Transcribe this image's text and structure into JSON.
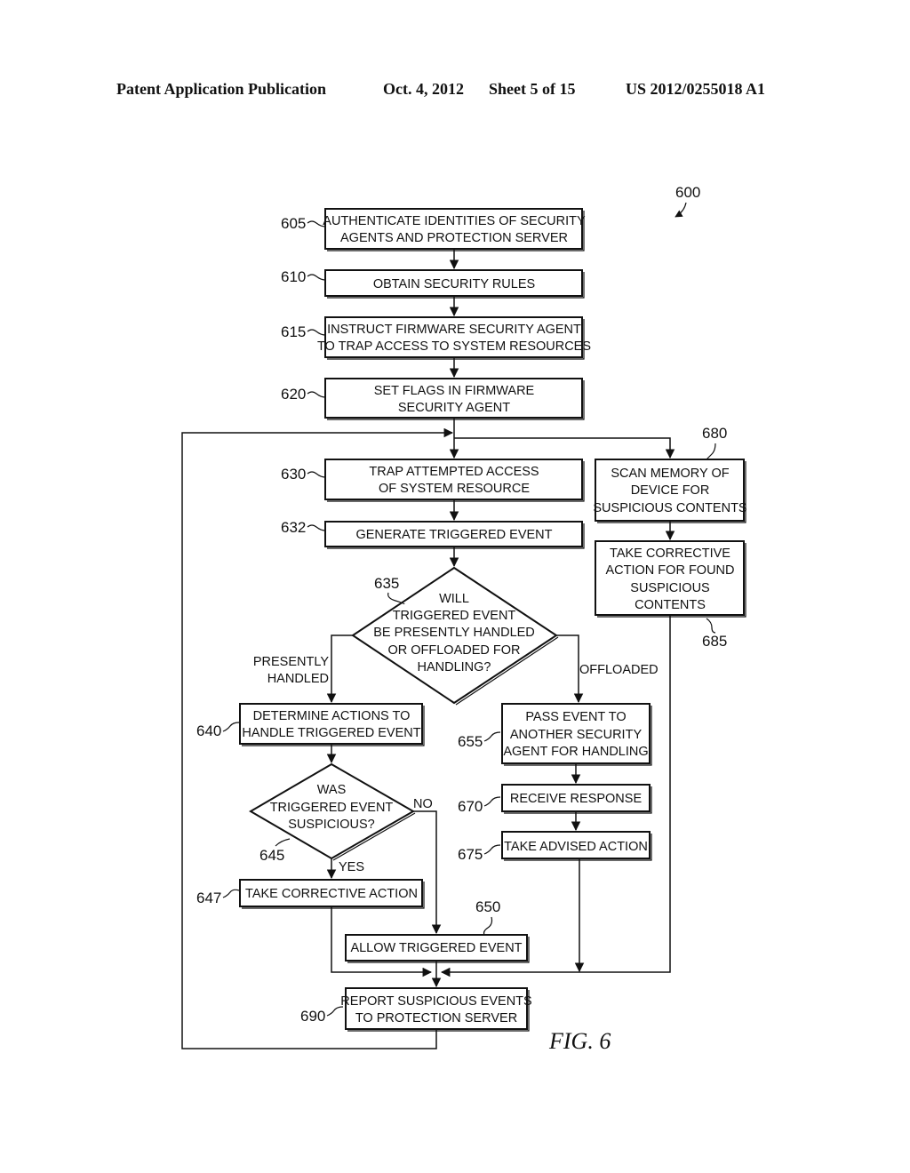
{
  "header": {
    "publication": "Patent Application Publication",
    "date": "Oct. 4, 2012",
    "sheet": "Sheet 5 of 15",
    "number": "US 2012/0255018 A1"
  },
  "figure": {
    "label": "FIG. 6",
    "ref": "600"
  },
  "steps": {
    "s605": {
      "ref": "605",
      "lines": [
        "AUTHENTICATE IDENTITIES OF SECURITY",
        "AGENTS AND PROTECTION SERVER"
      ]
    },
    "s610": {
      "ref": "610",
      "lines": [
        "OBTAIN SECURITY RULES"
      ]
    },
    "s615": {
      "ref": "615",
      "lines": [
        "INSTRUCT FIRMWARE SECURITY AGENT",
        "TO TRAP ACCESS TO SYSTEM RESOURCES"
      ]
    },
    "s620": {
      "ref": "620",
      "lines": [
        "SET FLAGS IN FIRMWARE",
        "SECURITY AGENT"
      ]
    },
    "s630": {
      "ref": "630",
      "lines": [
        "TRAP ATTEMPTED ACCESS",
        "OF SYSTEM RESOURCE"
      ]
    },
    "s632": {
      "ref": "632",
      "lines": [
        "GENERATE TRIGGERED EVENT"
      ]
    },
    "s635": {
      "ref": "635",
      "lines": [
        "WILL",
        "TRIGGERED EVENT",
        "BE PRESENTLY HANDLED",
        "OR OFFLOADED FOR",
        "HANDLING?"
      ]
    },
    "s640": {
      "ref": "640",
      "lines": [
        "DETERMINE ACTIONS TO",
        "HANDLE TRIGGERED EVENT"
      ]
    },
    "s645": {
      "ref": "645",
      "lines": [
        "WAS",
        "TRIGGERED EVENT",
        "SUSPICIOUS?"
      ]
    },
    "s647": {
      "ref": "647",
      "lines": [
        "TAKE CORRECTIVE ACTION"
      ]
    },
    "s650": {
      "ref": "650",
      "lines": [
        "ALLOW TRIGGERED EVENT"
      ]
    },
    "s655": {
      "ref": "655",
      "lines": [
        "PASS EVENT TO",
        "ANOTHER SECURITY",
        "AGENT FOR HANDLING"
      ]
    },
    "s670": {
      "ref": "670",
      "lines": [
        "RECEIVE RESPONSE"
      ]
    },
    "s675": {
      "ref": "675",
      "lines": [
        "TAKE ADVISED ACTION"
      ]
    },
    "s680": {
      "ref": "680",
      "lines": [
        "SCAN MEMORY OF",
        "DEVICE FOR",
        "SUSPICIOUS CONTENTS"
      ]
    },
    "s685": {
      "ref": "685",
      "lines": [
        "TAKE CORRECTIVE",
        "ACTION FOR FOUND",
        "SUSPICIOUS",
        "CONTENTS"
      ]
    },
    "s690": {
      "ref": "690",
      "lines": [
        "REPORT SUSPICIOUS EVENTS",
        "TO PROTECTION SERVER"
      ]
    }
  },
  "branch_labels": {
    "presently_handled": [
      "PRESENTLY",
      "HANDLED"
    ],
    "offloaded": "OFFLOADED",
    "no": "NO",
    "yes": "YES"
  }
}
